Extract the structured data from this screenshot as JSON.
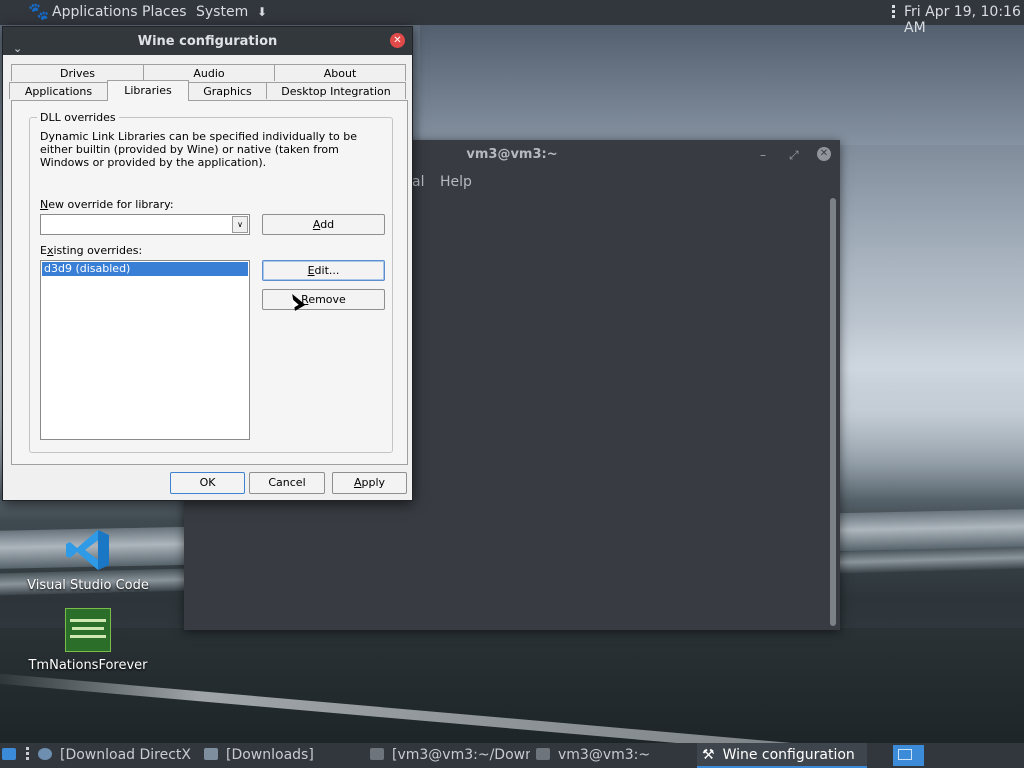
{
  "top_panel": {
    "applications": "Applications",
    "places": "Places",
    "system": "System",
    "clock": "Fri Apr 19, 10:16 AM"
  },
  "desktop": {
    "icons": [
      {
        "label": "Visual Studio Code"
      },
      {
        "label": "TmNationsForever"
      }
    ]
  },
  "terminal": {
    "title": "vm3@vm3:~",
    "menu_partial": "al",
    "menu_help": "Help"
  },
  "wine": {
    "title": "Wine configuration",
    "tabs_row1": [
      "Drives",
      "Audio",
      "About"
    ],
    "tabs_row2": [
      "Applications",
      "Libraries",
      "Graphics",
      "Desktop Integration"
    ],
    "active_tab": "Libraries",
    "group_title": "DLL overrides",
    "description": "Dynamic Link Libraries can be specified individually to be either builtin (provided by Wine) or native (taken from Windows or provided by the application).",
    "new_override_label": "New override for library:",
    "new_override_value": "",
    "add_label": "Add",
    "existing_label": "Existing overrides:",
    "overrides": [
      "d3d9 (disabled)"
    ],
    "edit_label": "Edit...",
    "remove_label": "Remove",
    "ok_label": "OK",
    "cancel_label": "Cancel",
    "apply_label": "Apply"
  },
  "taskbar": {
    "tasks": [
      {
        "label": "[Download DirectX ..."
      },
      {
        "label": "[Downloads]"
      },
      {
        "label": "[vm3@vm3:~/Down..."
      },
      {
        "label": "vm3@vm3:~"
      },
      {
        "label": "Wine configuration"
      }
    ]
  },
  "colors": {
    "panel": "#32373d",
    "accent": "#3b8bd9",
    "close_red": "#e04a48",
    "selection": "#3a7fd6"
  }
}
